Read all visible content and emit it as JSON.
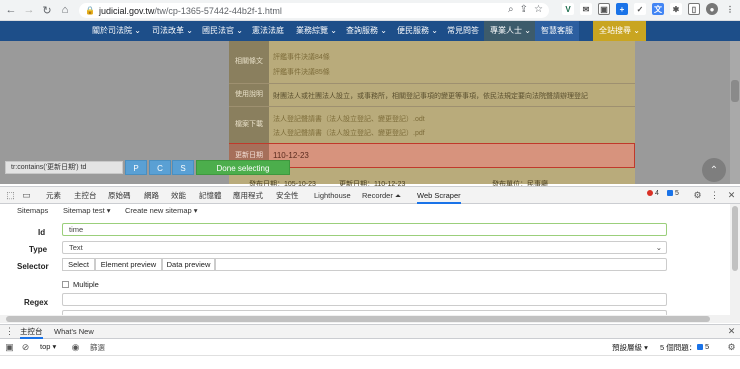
{
  "browser": {
    "url_host": "judicial.gov.tw",
    "url_path": "/tw/cp-1365-57442-44b2f-1.html"
  },
  "site_nav": [
    {
      "label": "關於司法院 ⌄"
    },
    {
      "label": "司法改革 ⌄"
    },
    {
      "label": "國民法官 ⌄"
    },
    {
      "label": "憲法法庭"
    },
    {
      "label": "業務綜覽 ⌄"
    },
    {
      "label": "查詢服務 ⌄"
    },
    {
      "label": "便民服務 ⌄"
    },
    {
      "label": "常見問答"
    },
    {
      "label": "專業人士 ⌄"
    },
    {
      "label": "智慧客服"
    },
    {
      "label": "全站搜尋 ⌄"
    }
  ],
  "page": {
    "links_top": [
      "評鑑事件決議84條",
      "評鑑事件決議85條"
    ],
    "label_related": "相關條文",
    "label_usage": "使用說明",
    "usage_text": "財團法人或社團法人設立，或事務所，相關登記事項的變更等事項，依民法規定要向法院聲請辦理登記",
    "label_download": "檔案下載",
    "downloads": [
      "法人登記聲請書（法人設立登記、變更登記）.odt",
      "法人登記聲請書（法人設立登記、變更登記）.pdf"
    ],
    "label_updated": "更新日期",
    "updated_value": "110-12-23",
    "footer_published": "發布日期：105-10-23",
    "footer_updated": "更新日期：110-12-23",
    "footer_unit": "發布單位：民事廳"
  },
  "scraper_overlay": {
    "selector_text": "tr:contains('更新日期') td",
    "btn_p": "P",
    "btn_c": "C",
    "btn_s": "S",
    "done_label": "Done selecting"
  },
  "devtools": {
    "tabs": [
      "元素",
      "主控台",
      "原始碼",
      "網路",
      "效能",
      "記憶體",
      "應用程式",
      "安全性",
      "Lighthouse",
      "Recorder ⏶",
      "Web Scraper"
    ],
    "errors": "4",
    "messages": "5"
  },
  "webscraper": {
    "tabs": [
      "Sitemaps",
      "Sitemap test ▾",
      "Create new sitemap ▾"
    ],
    "id_label": "Id",
    "id_value": "time",
    "type_label": "Type",
    "type_value": "Text",
    "selector_label": "Selector",
    "select_btn": "Select",
    "element_preview_btn": "Element preview",
    "data_preview_btn": "Data preview",
    "multiple_label": "Multiple",
    "regex_label": "Regex"
  },
  "drawer": {
    "tab_console": "主控台",
    "tab_whatsnew": "What's New",
    "context": "top",
    "filter_placeholder": "篩選",
    "level": "預設層級 ▾",
    "issues": "5 個問題：",
    "issues_count": "5"
  }
}
